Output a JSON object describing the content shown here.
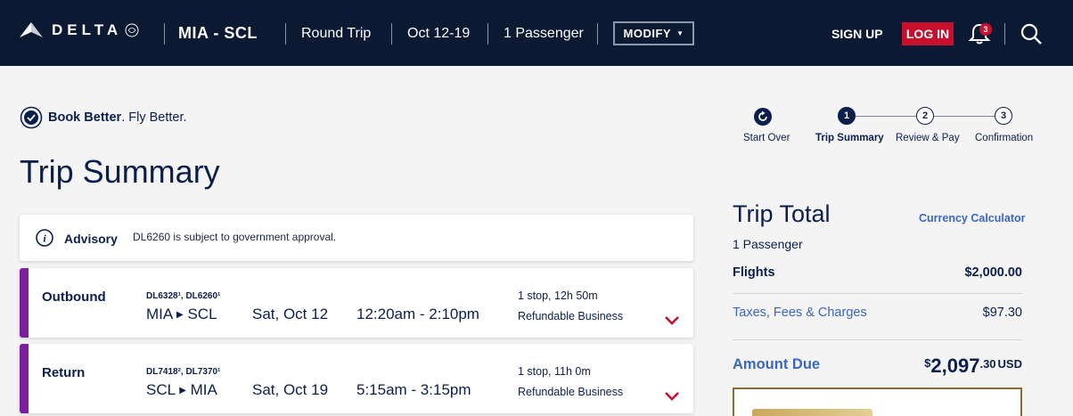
{
  "header": {
    "brand": "DELTA",
    "route": "MIA - SCL",
    "trip_type": "Round Trip",
    "dates": "Oct 12-19",
    "passengers": "1 Passenger",
    "modify_label": "MODIFY",
    "signup_label": "SIGN UP",
    "login_label": "LOG IN",
    "notification_count": "3",
    "colors": {
      "bar": "#0b1933",
      "login": "#c8102e"
    }
  },
  "tagline": {
    "bold": "Book Better",
    "rest": ". Fly Better."
  },
  "page_title": "Trip Summary",
  "stepper": {
    "start_over": "Start Over",
    "steps": [
      {
        "num": "1",
        "label": "Trip Summary",
        "active": true
      },
      {
        "num": "2",
        "label": "Review & Pay",
        "active": false
      },
      {
        "num": "3",
        "label": "Confirmation",
        "active": false
      }
    ]
  },
  "advisory": {
    "label": "Advisory",
    "text": "DL6260 is subject to government approval."
  },
  "flights": [
    {
      "kind": "Outbound",
      "flight_numbers": "DL6328¹, DL6260¹",
      "origin": "MIA",
      "destination": "SCL",
      "date": "Sat, Oct 12",
      "time": "12:20am - 2:10pm",
      "stops": "1 stop, 12h 50m",
      "cabin": "Refundable Business"
    },
    {
      "kind": "Return",
      "flight_numbers": "DL7418², DL7370¹",
      "origin": "SCL",
      "destination": "MIA",
      "date": "Sat, Oct 19",
      "time": "5:15am - 3:15pm",
      "stops": "1 stop, 11h 0m",
      "cabin": "Refundable Business"
    }
  ],
  "trip_total": {
    "title": "Trip Total",
    "currency_link": "Currency Calculator",
    "passengers": "1 Passenger",
    "flights_label": "Flights",
    "flights_value": "$2,000.00",
    "taxes_label": "Taxes, Fees & Charges",
    "taxes_value": "$97.30",
    "amount_due_label": "Amount Due",
    "amount_due": {
      "symbol": "$",
      "whole": "2,097",
      "cents": ".30",
      "currency": "USD"
    }
  }
}
